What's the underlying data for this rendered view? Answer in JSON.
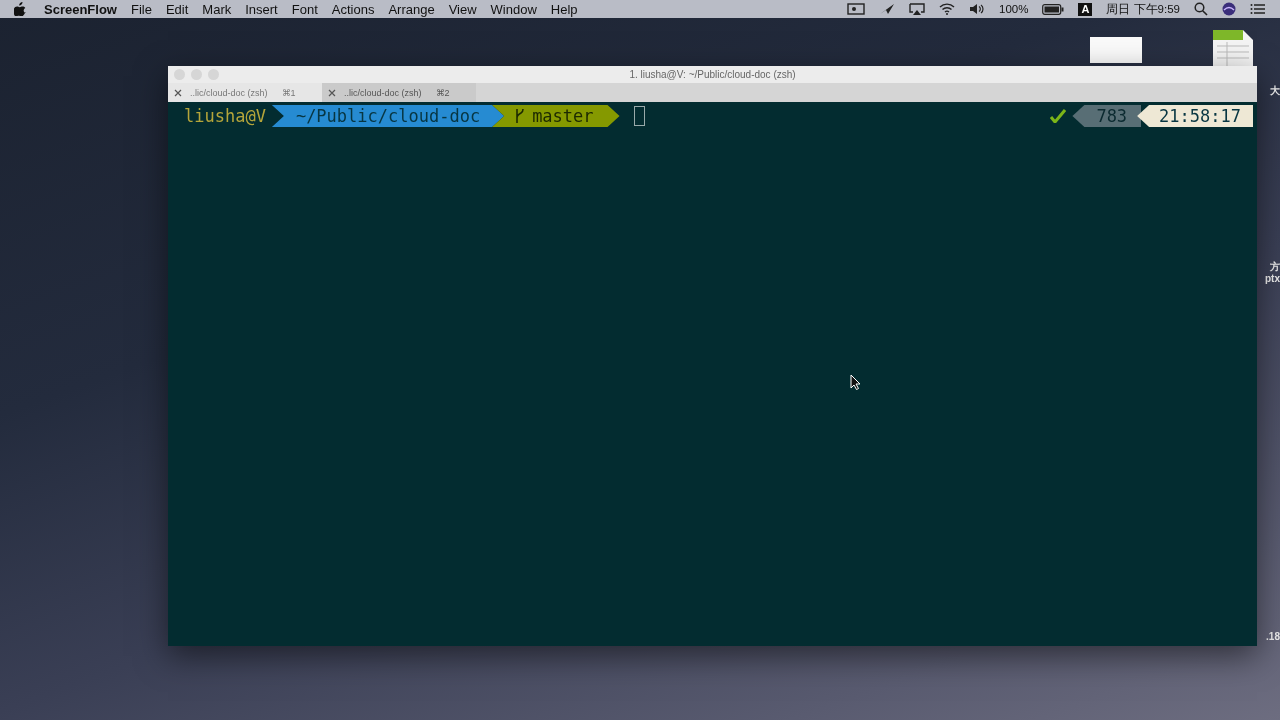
{
  "menu_bar": {
    "app_name": "ScreenFlow",
    "items": [
      "File",
      "Edit",
      "Mark",
      "Insert",
      "Font",
      "Actions",
      "Arrange",
      "View",
      "Window",
      "Help"
    ],
    "battery": "100%",
    "input_method": "A",
    "clock": "周日 下午9:59"
  },
  "desktop_labels": [
    {
      "text": "大"
    },
    {
      "text": "方"
    },
    {
      "text": "ptx"
    },
    {
      "text": ".18"
    }
  ],
  "window": {
    "title": "1. liusha@V: ~/Public/cloud-doc (zsh)"
  },
  "tabs": [
    {
      "label": "..lic/cloud-doc (zsh)",
      "shortcut": "⌘1",
      "selected": true
    },
    {
      "label": "..lic/cloud-doc (zsh)",
      "shortcut": "⌘2",
      "selected": false
    }
  ],
  "prompt": {
    "user": "liusha@V",
    "path": "~/Public/cloud-doc",
    "branch": "master",
    "status_ok": true,
    "history": "783",
    "time": "21:58:17"
  }
}
